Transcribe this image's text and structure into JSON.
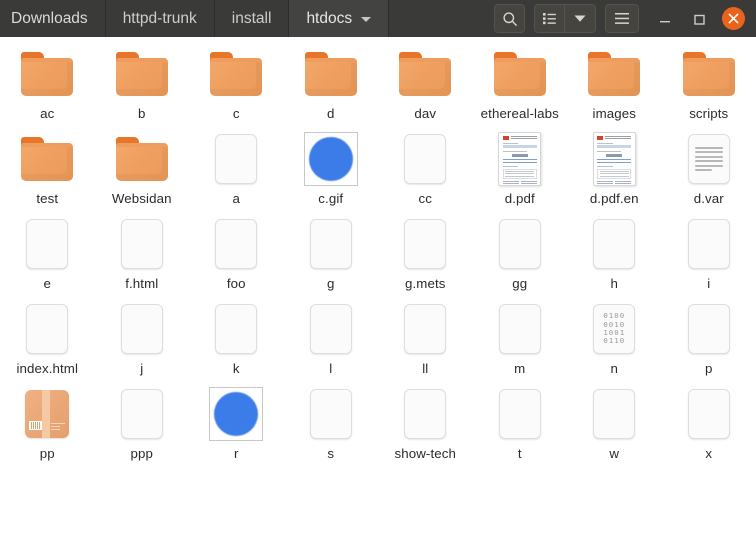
{
  "window": {
    "breadcrumbs": [
      {
        "label": "Downloads",
        "active": false,
        "has_menu": false
      },
      {
        "label": "httpd-trunk",
        "active": false,
        "has_menu": false
      },
      {
        "label": "install",
        "active": false,
        "has_menu": false
      },
      {
        "label": "htdocs",
        "active": true,
        "has_menu": true
      }
    ],
    "toolbar": [
      {
        "name": "search-icon",
        "label": "Search"
      },
      {
        "name": "view-list-icon",
        "label": "View options"
      },
      {
        "name": "chevron-down-icon",
        "label": "View options menu"
      },
      {
        "name": "hamburger-menu-icon",
        "label": "Main menu"
      }
    ],
    "controls": [
      {
        "name": "minimize-button",
        "label": "Minimize"
      },
      {
        "name": "maximize-button",
        "label": "Maximize"
      },
      {
        "name": "close-button",
        "label": "Close"
      }
    ],
    "accent_color": "#e8641c",
    "titlebar_color": "#3a3a38"
  },
  "files": [
    [
      {
        "name": "ac",
        "type": "folder",
        "selected": false
      },
      {
        "name": "b",
        "type": "folder",
        "selected": false
      },
      {
        "name": "c",
        "type": "folder",
        "selected": false
      },
      {
        "name": "d",
        "type": "folder",
        "selected": false
      },
      {
        "name": "dav",
        "type": "folder",
        "selected": false
      },
      {
        "name": "ethereal-labs",
        "type": "folder",
        "selected": false
      },
      {
        "name": "images",
        "type": "folder",
        "selected": false
      },
      {
        "name": "scripts",
        "type": "folder",
        "selected": false
      }
    ],
    [
      {
        "name": "test",
        "type": "folder",
        "selected": false
      },
      {
        "name": "Websidan",
        "type": "folder",
        "selected": false
      },
      {
        "name": "a",
        "type": "code",
        "selected": false
      },
      {
        "name": "c.gif",
        "type": "image",
        "selected": false
      },
      {
        "name": "cc",
        "type": "code",
        "selected": false
      },
      {
        "name": "d.pdf",
        "type": "pdf",
        "selected": false
      },
      {
        "name": "d.pdf.en",
        "type": "pdf",
        "selected": false
      },
      {
        "name": "d.var",
        "type": "text",
        "selected": false
      }
    ],
    [
      {
        "name": "e",
        "type": "code",
        "selected": false
      },
      {
        "name": "f.html",
        "type": "code",
        "selected": false
      },
      {
        "name": "foo",
        "type": "code",
        "selected": false
      },
      {
        "name": "g",
        "type": "code",
        "selected": false
      },
      {
        "name": "g.mets",
        "type": "code",
        "selected": false
      },
      {
        "name": "gg",
        "type": "code",
        "selected": false
      },
      {
        "name": "h",
        "type": "code",
        "selected": false
      },
      {
        "name": "i",
        "type": "code",
        "selected": false
      }
    ],
    [
      {
        "name": "index.html",
        "type": "code",
        "selected": false
      },
      {
        "name": "j",
        "type": "code",
        "selected": false
      },
      {
        "name": "k",
        "type": "code",
        "selected": false
      },
      {
        "name": "l",
        "type": "code",
        "selected": false
      },
      {
        "name": "ll",
        "type": "code",
        "selected": false
      },
      {
        "name": "m",
        "type": "code",
        "selected": false
      },
      {
        "name": "n",
        "type": "binary",
        "selected": false
      },
      {
        "name": "p",
        "type": "code",
        "selected": false
      }
    ],
    [
      {
        "name": "pp",
        "type": "package",
        "selected": false
      },
      {
        "name": "ppp",
        "type": "code",
        "selected": false
      },
      {
        "name": "r",
        "type": "image",
        "selected": false
      },
      {
        "name": "s",
        "type": "code",
        "selected": false
      },
      {
        "name": "show-tech",
        "type": "code",
        "selected": false
      },
      {
        "name": "t",
        "type": "code",
        "selected": false
      },
      {
        "name": "w",
        "type": "code",
        "selected": false
      },
      {
        "name": "x",
        "type": "code",
        "selected": false
      }
    ]
  ],
  "icons": {
    "code_glyph": "</>",
    "binary_lines": [
      "0100",
      "0010",
      "1001",
      "0110"
    ]
  }
}
